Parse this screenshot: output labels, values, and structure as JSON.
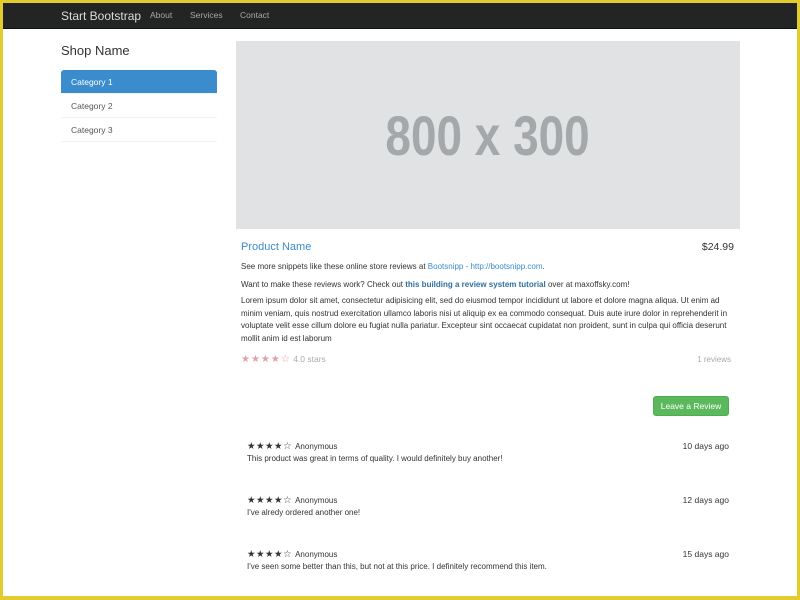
{
  "navbar": {
    "brand": "Start Bootstrap",
    "links": [
      "About",
      "Services",
      "Contact"
    ]
  },
  "sidebar": {
    "shop_name": "Shop Name",
    "categories": [
      "Category 1",
      "Category 2",
      "Category 3"
    ],
    "active_index": 0
  },
  "hero": {
    "placeholder": "800 x 300"
  },
  "product": {
    "name": "Product Name",
    "price": "$24.99",
    "line1_prefix": "See more snippets like these online store reviews at",
    "line1_link": "Bootsnipp - http://bootsnipp.com",
    "line1_suffix": ".",
    "line2_prefix": "Want to make these reviews work? Check out",
    "line2_link": "this building a review system tutorial",
    "line2_suffix": "over at maxoffsky.com!",
    "description": "Lorem ipsum dolor sit amet, consectetur adipisicing elit, sed do eiusmod tempor incididunt ut labore et dolore magna aliqua. Ut enim ad minim veniam, quis nostrud exercitation ullamco laboris nisi ut aliquip ex ea commodo consequat. Duis aute irure dolor in reprehenderit in voluptate velit esse cillum dolore eu fugiat nulla pariatur. Excepteur sint occaecat cupidatat non proident, sunt in culpa qui officia deserunt mollit anim id est laborum",
    "stars": "★★★★☆",
    "rating_text": "4.0 stars",
    "reviews_count": "1 reviews"
  },
  "actions": {
    "leave_review": "Leave a Review"
  },
  "reviews": [
    {
      "stars": "★★★★☆",
      "author": "Anonymous",
      "when": "10 days ago",
      "text": "This product was great in terms of quality. I would definitely buy another!"
    },
    {
      "stars": "★★★★☆",
      "author": "Anonymous",
      "when": "12 days ago",
      "text": "I've alredy ordered another one!"
    },
    {
      "stars": "★★★★☆",
      "author": "Anonymous",
      "when": "15 days ago",
      "text": "I've seen some better than this, but not at this price. I definitely recommend this item."
    }
  ],
  "colors": {
    "accent": "#3a8ccc",
    "success": "#5cb85c",
    "navbar": "#222523",
    "frame": "#e3cc2e"
  }
}
